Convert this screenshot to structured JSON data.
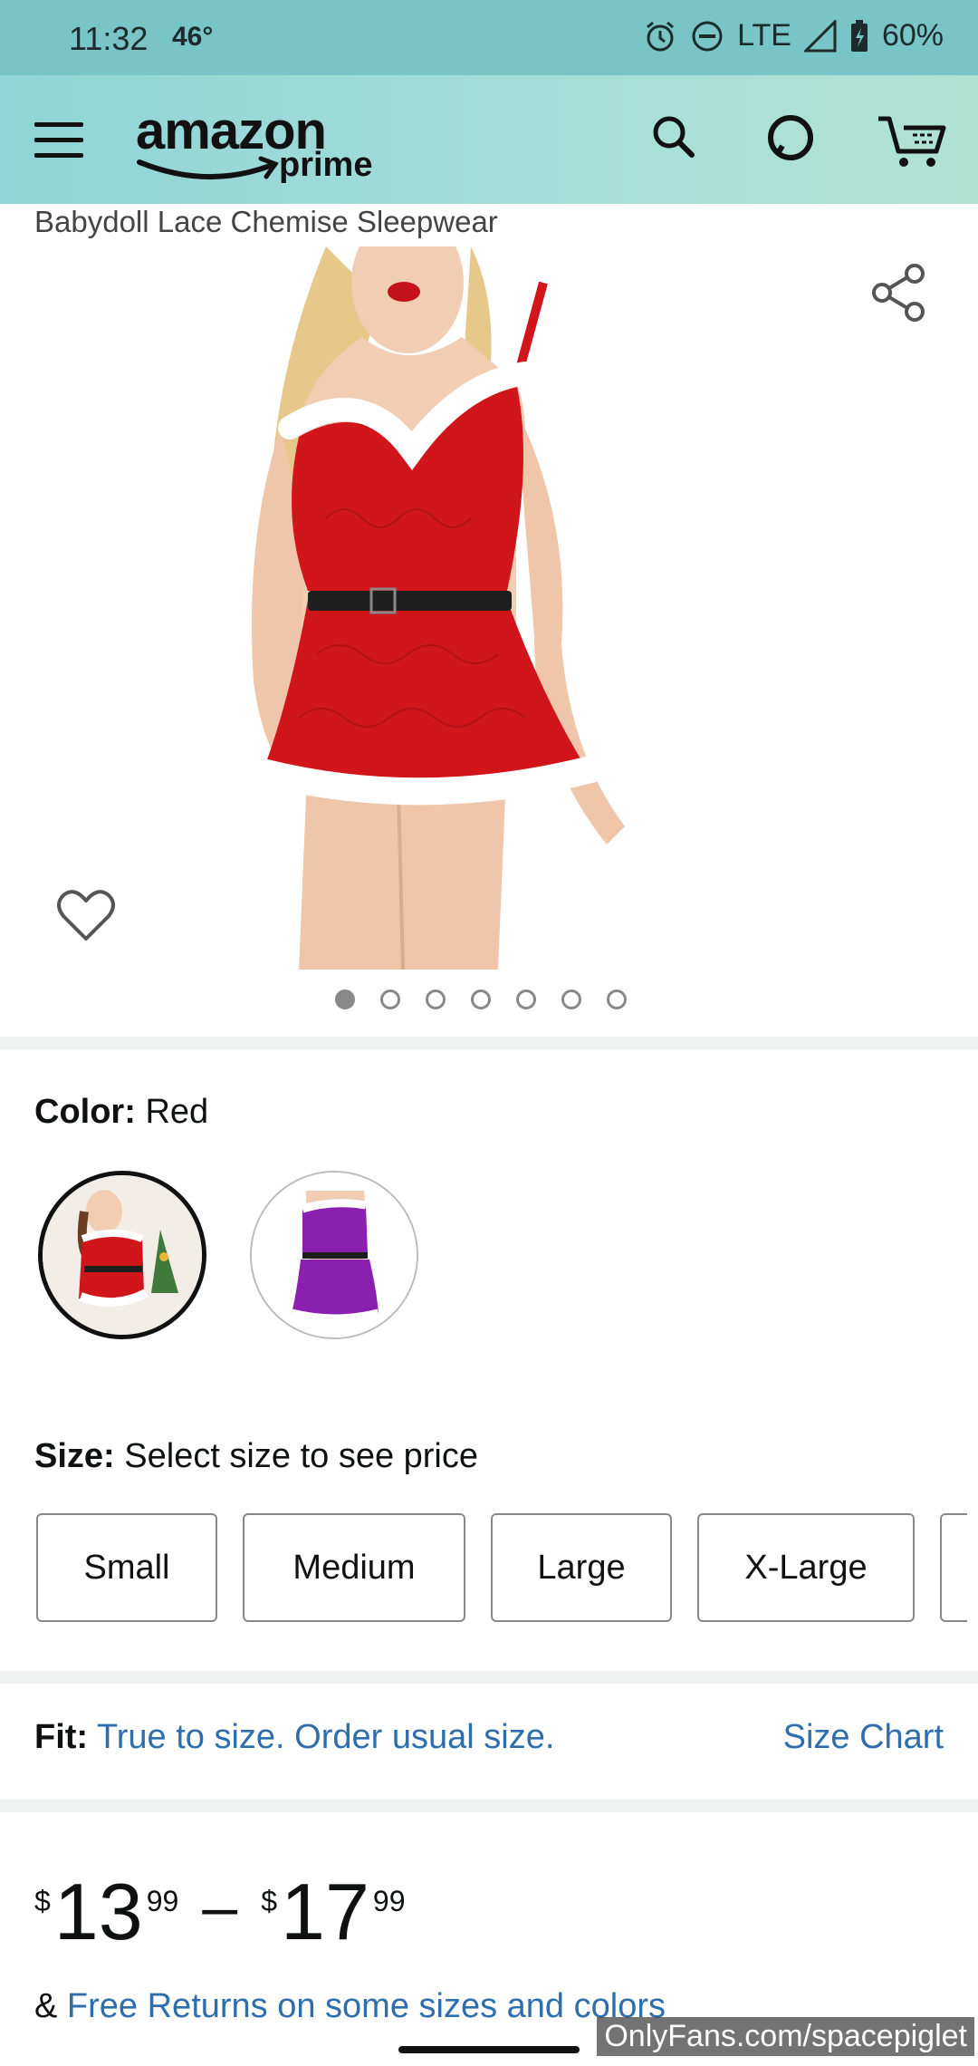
{
  "status_bar": {
    "time": "11:32",
    "temp": "46°",
    "network": "LTE",
    "battery": "60%"
  },
  "header": {
    "logo_amazon": "amazon",
    "logo_prime": "prime"
  },
  "product": {
    "subtitle": "Babydoll Lace Chemise Sleepwear",
    "image_count": 7,
    "active_image_index": 0
  },
  "color": {
    "label": "Color:",
    "value": "Red",
    "options": [
      "Red",
      "Purple"
    ]
  },
  "size": {
    "label": "Size:",
    "prompt": "Select size to see price",
    "options": [
      "Small",
      "Medium",
      "Large",
      "X-Large"
    ]
  },
  "fit": {
    "label": "Fit:",
    "text": "True to size. Order usual size.",
    "size_chart": "Size Chart"
  },
  "price": {
    "low": {
      "currency": "$",
      "whole": "13",
      "fraction": "99"
    },
    "high": {
      "currency": "$",
      "whole": "17",
      "fraction": "99"
    },
    "separator": "–"
  },
  "returns": {
    "prefix": "&",
    "link": "Free Returns on some sizes and colors"
  },
  "watermark": "OnlyFans.com/spacepiglet",
  "colors": {
    "header_teal": "#8fd4d6",
    "status_teal": "#78c4c7",
    "link_blue": "#2e6ead",
    "product_red": "#d0161b",
    "swatch_purple": "#8a1fb0"
  }
}
